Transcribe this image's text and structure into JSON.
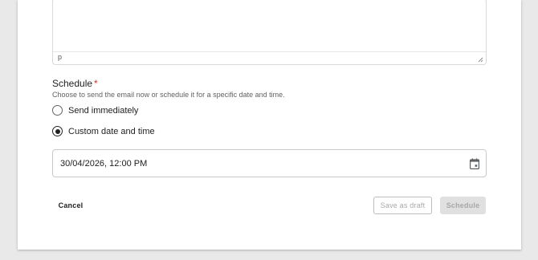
{
  "editor": {
    "status_path": "p"
  },
  "schedule": {
    "title": "Schedule",
    "required_marker": "*",
    "description": "Choose to send the email now or schedule it for a specific date and time.",
    "options": [
      {
        "label": "Send immediately",
        "selected": false
      },
      {
        "label": "Custom date and time",
        "selected": true
      }
    ],
    "datetime_value": "30/04/2026, 12:00 PM"
  },
  "actions": {
    "cancel_label": "Cancel",
    "save_draft_label": "Save as draft",
    "schedule_label": "Schedule"
  },
  "colors": {
    "required": "#d32f2f",
    "disabled_text": "#a8a8a8",
    "disabled_bg": "#e0e0e0"
  }
}
